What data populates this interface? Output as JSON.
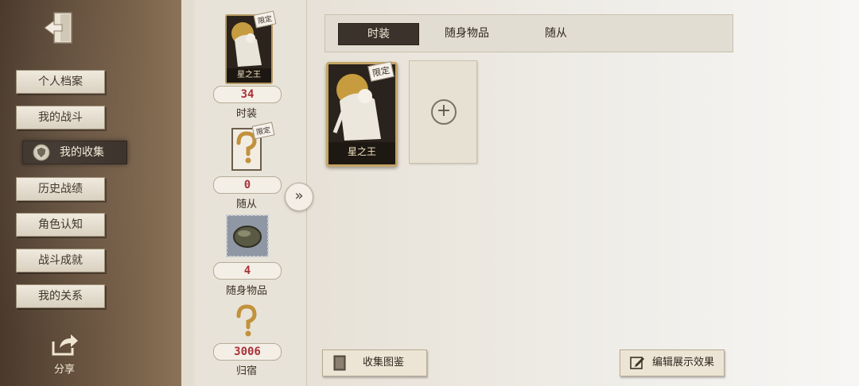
{
  "sidebar": {
    "items": [
      {
        "label": "个人档案"
      },
      {
        "label": "我的战斗"
      },
      {
        "label": "我的收集"
      },
      {
        "label": "历史战绩"
      },
      {
        "label": "角色认知"
      },
      {
        "label": "战斗成就"
      },
      {
        "label": "我的关系"
      }
    ],
    "share_label": "分享"
  },
  "stats": {
    "costume": {
      "count": "34",
      "label": "时装",
      "tag": "限定",
      "card_name": "星之王"
    },
    "pet": {
      "count": "0",
      "label": "随从",
      "tag": "限定"
    },
    "accessory": {
      "count": "4",
      "label": "随身物品"
    },
    "home": {
      "count": "3006",
      "label": "归宿"
    }
  },
  "tabs": [
    {
      "label": "时装",
      "active": true
    },
    {
      "label": "随身物品",
      "active": false
    },
    {
      "label": "随从",
      "active": false
    }
  ],
  "showcase": {
    "card_name": "星之王",
    "card_tag": "限定",
    "empty_slot_symbol": "+"
  },
  "buttons": {
    "collection_guide": "收集图鉴",
    "edit_display": "编辑展示效果",
    "expand_symbol": "»"
  },
  "colors": {
    "accent_red": "#a9323a",
    "active_dark": "#3a322b",
    "card_gold": "#c4a567"
  }
}
